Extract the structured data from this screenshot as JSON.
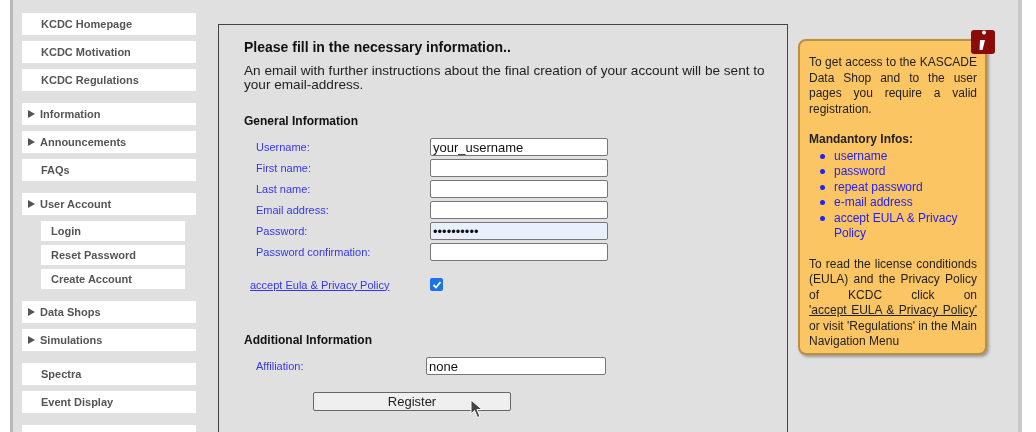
{
  "sidebar": {
    "groups": [
      {
        "items": [
          {
            "label": "KCDC Homepage",
            "expandable": false
          },
          {
            "label": "KCDC Motivation",
            "expandable": false
          },
          {
            "label": "KCDC Regulations",
            "expandable": false
          }
        ]
      },
      {
        "items": [
          {
            "label": "Information",
            "expandable": true
          },
          {
            "label": "Announcements",
            "expandable": true
          },
          {
            "label": "FAQs",
            "expandable": false
          }
        ]
      },
      {
        "items": [
          {
            "label": "User Account",
            "expandable": true,
            "children": [
              {
                "label": "Login"
              },
              {
                "label": "Reset Password"
              },
              {
                "label": "Create Account"
              }
            ]
          }
        ]
      },
      {
        "items": [
          {
            "label": "Data Shops",
            "expandable": true
          },
          {
            "label": "Simulations",
            "expandable": true
          }
        ]
      },
      {
        "items": [
          {
            "label": "Spectra",
            "expandable": false
          },
          {
            "label": "Event Display",
            "expandable": false
          }
        ]
      },
      {
        "items": [
          {
            "kind": "blank"
          }
        ]
      }
    ]
  },
  "form": {
    "title": "Please fill in the necessary information..",
    "intro": "An email with further instructions about the final creation of your account will be sent to your email-address.",
    "general": {
      "heading": "General Information",
      "fields": [
        {
          "label": "Username:",
          "value": "your_username",
          "highlighted": false
        },
        {
          "label": "First name:",
          "highlighted": false
        },
        {
          "label": "Last name:",
          "highlighted": false
        },
        {
          "label": "Email address:",
          "highlighted": false
        },
        {
          "label": "Password:",
          "value": "••••••••••",
          "highlighted": true
        },
        {
          "label": "Password confirmation:",
          "highlighted": false
        }
      ]
    },
    "eula": {
      "label": "accept Eula & Privacy Policy",
      "checked": true
    },
    "additional": {
      "heading": "Additional Information",
      "fields": [
        {
          "label": "Affiliation:",
          "value": "none",
          "highlighted": false
        }
      ]
    },
    "submit": "Register"
  },
  "info_box": {
    "intro": "To get access to the KASCADE Data Shop and to the user pages you require a valid registration.",
    "mandatory_heading": "Mandantory Infos:",
    "mandatory": [
      "username",
      "password",
      "repeat password",
      "e-mail address",
      "accept EULA & Privacy Policy"
    ],
    "note_before": "To read the license conditionds (EULA) and the Privacy Policy of KCDC click on",
    "note_link": "'accept EULA & Privacy Policy'",
    "note_after": "or visit 'Regulations' in the Main Navigation Menu"
  }
}
